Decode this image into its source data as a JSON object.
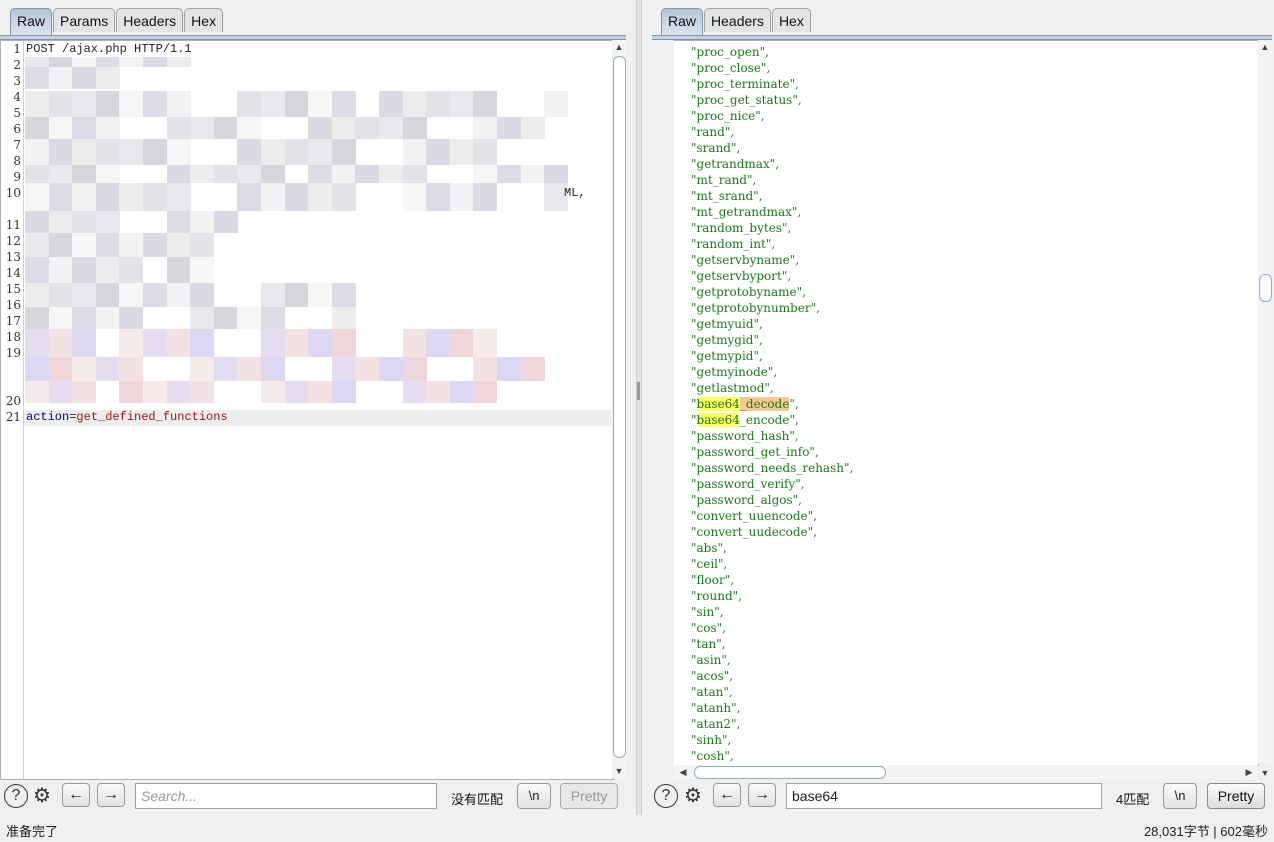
{
  "left": {
    "tabs": [
      "Raw",
      "Params",
      "Headers",
      "Hex"
    ],
    "active_tab": "Raw",
    "line_numbers": [
      "1",
      "2",
      "3",
      "4",
      "5",
      "6",
      "7",
      "8",
      "9",
      "10",
      "11",
      "12",
      "13",
      "14",
      "15",
      "16",
      "17",
      "18",
      "19",
      "20",
      "21"
    ],
    "first_line": "POST /ajax.php HTTP/1.1",
    "line10_tail": "ML,",
    "body_key": "action",
    "body_eq": "=",
    "body_value": "get_defined_functions",
    "search_placeholder": "Search...",
    "search_value": "",
    "match_text": "没有匹配",
    "newline_label": "\\n",
    "pretty_label": "Pretty"
  },
  "right": {
    "tabs": [
      "Raw",
      "Headers",
      "Hex"
    ],
    "active_tab": "Raw",
    "lines": [
      "\"proc_open\",",
      "\"proc_close\",",
      "\"proc_terminate\",",
      "\"proc_get_status\",",
      "\"proc_nice\",",
      "\"rand\",",
      "\"srand\",",
      "\"getrandmax\",",
      "\"mt_rand\",",
      "\"mt_srand\",",
      "\"mt_getrandmax\",",
      "\"random_bytes\",",
      "\"random_int\",",
      "\"getservbyname\",",
      "\"getservbyport\",",
      "\"getprotobyname\",",
      "\"getprotobynumber\",",
      "\"getmyuid\",",
      "\"getmygid\",",
      "\"getmypid\",",
      "\"getmyinode\",",
      "\"getlastmod\","
    ],
    "hl_line1": {
      "pre": "\"",
      "match": "base64",
      "rest": "_decode",
      "post": "\","
    },
    "hl_line2": {
      "pre": "\"",
      "match": "base64",
      "rest": "_encode\","
    },
    "lines2": [
      "\"password_hash\",",
      "\"password_get_info\",",
      "\"password_needs_rehash\",",
      "\"password_verify\",",
      "\"password_algos\",",
      "\"convert_uuencode\",",
      "\"convert_uudecode\",",
      "\"abs\",",
      "\"ceil\",",
      "\"floor\",",
      "\"round\",",
      "\"sin\",",
      "\"cos\",",
      "\"tan\",",
      "\"asin\",",
      "\"acos\",",
      "\"atan\",",
      "\"atanh\",",
      "\"atan2\",",
      "\"sinh\",",
      "\"cosh\","
    ],
    "search_value": "base64",
    "match_text": "4匹配",
    "newline_label": "\\n",
    "pretty_label": "Pretty"
  },
  "status": {
    "left": "准备完了",
    "right": "28,031字节 | 602毫秒"
  },
  "colors": {
    "string_green": "#1a7a1a",
    "keyword_blue": "#00008b",
    "value_red": "#a31515",
    "highlight_current": "#f8c890",
    "highlight_match": "#ffff66",
    "tab_active": "#b4c6d8"
  },
  "icons": [
    "help-icon",
    "settings-icon",
    "arrow-left-icon",
    "arrow-right-icon"
  ]
}
